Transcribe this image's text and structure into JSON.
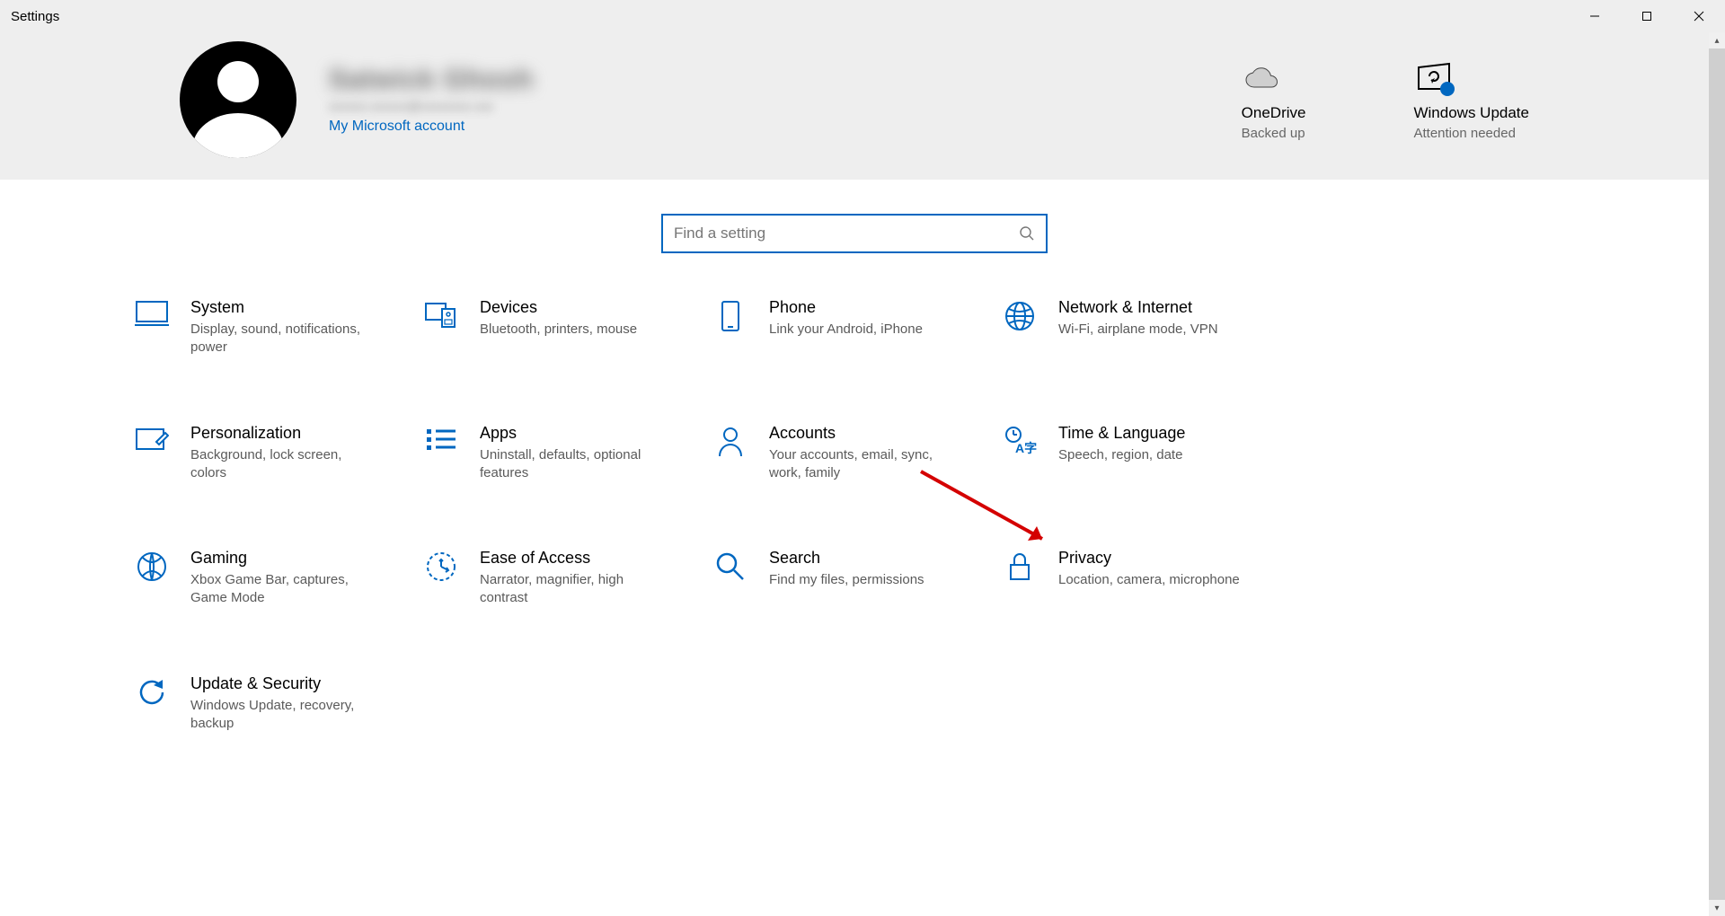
{
  "window": {
    "title": "Settings"
  },
  "hero": {
    "user_name": "Satwick Ghosh",
    "user_email": "xxxxxx.xxxxxx@xxxxxxxx.xxx",
    "account_link": "My Microsoft account",
    "cards": [
      {
        "title": "OneDrive",
        "sub": "Backed up"
      },
      {
        "title": "Windows Update",
        "sub": "Attention needed"
      }
    ]
  },
  "search": {
    "placeholder": "Find a setting"
  },
  "categories": [
    {
      "title": "System",
      "sub": "Display, sound, notifications, power"
    },
    {
      "title": "Devices",
      "sub": "Bluetooth, printers, mouse"
    },
    {
      "title": "Phone",
      "sub": "Link your Android, iPhone"
    },
    {
      "title": "Network & Internet",
      "sub": "Wi-Fi, airplane mode, VPN"
    },
    {
      "title": "Personalization",
      "sub": "Background, lock screen, colors"
    },
    {
      "title": "Apps",
      "sub": "Uninstall, defaults, optional features"
    },
    {
      "title": "Accounts",
      "sub": "Your accounts, email, sync, work, family"
    },
    {
      "title": "Time & Language",
      "sub": "Speech, region, date"
    },
    {
      "title": "Gaming",
      "sub": "Xbox Game Bar, captures, Game Mode"
    },
    {
      "title": "Ease of Access",
      "sub": "Narrator, magnifier, high contrast"
    },
    {
      "title": "Search",
      "sub": "Find my files, permissions"
    },
    {
      "title": "Privacy",
      "sub": "Location, camera, microphone"
    },
    {
      "title": "Update & Security",
      "sub": "Windows Update, recovery, backup"
    }
  ]
}
